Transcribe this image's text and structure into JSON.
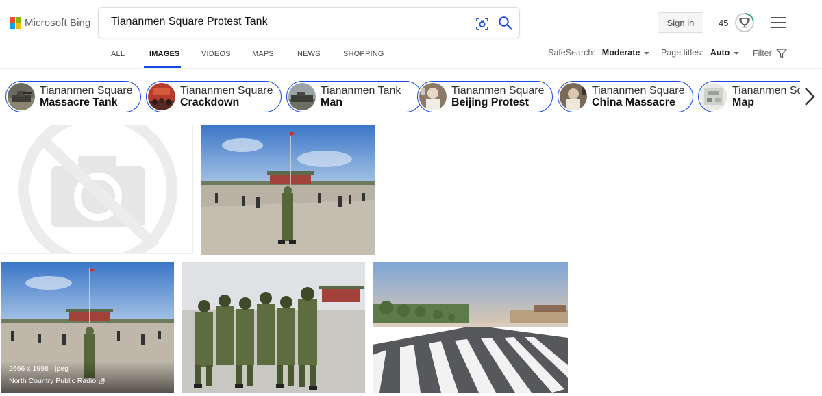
{
  "brand": {
    "name": "Microsoft Bing",
    "colors": [
      "#f25022",
      "#7fba00",
      "#00a4ef",
      "#ffb900"
    ]
  },
  "search": {
    "query": "Tiananmen Square Protest Tank"
  },
  "header": {
    "sign_in": "Sign in",
    "points": "45"
  },
  "nav": {
    "tabs": [
      "ALL",
      "IMAGES",
      "VIDEOS",
      "MAPS",
      "NEWS",
      "SHOPPING"
    ],
    "active": "IMAGES",
    "safesearch_label": "SafeSearch:",
    "safesearch_value": "Moderate",
    "page_titles_label": "Page titles:",
    "page_titles_value": "Auto",
    "filter": "Filter"
  },
  "related": [
    {
      "line1": "Tiananmen Square",
      "line2": "Massacre Tank"
    },
    {
      "line1": "Tiananmen Square",
      "line2": "Crackdown"
    },
    {
      "line1": "Tiananmen Tank",
      "line2": "Man"
    },
    {
      "line1": "Tiananmen Square",
      "line2": "Beijing Protest"
    },
    {
      "line1": "Tiananmen Square",
      "line2": "China Massacre"
    },
    {
      "line1": "Tiananmen Square",
      "line2": "Map"
    }
  ],
  "results": [
    {
      "dims": "2666 x 1998 · jpeg",
      "source": "North Country Public Radio"
    }
  ],
  "accent": "#174ae4"
}
